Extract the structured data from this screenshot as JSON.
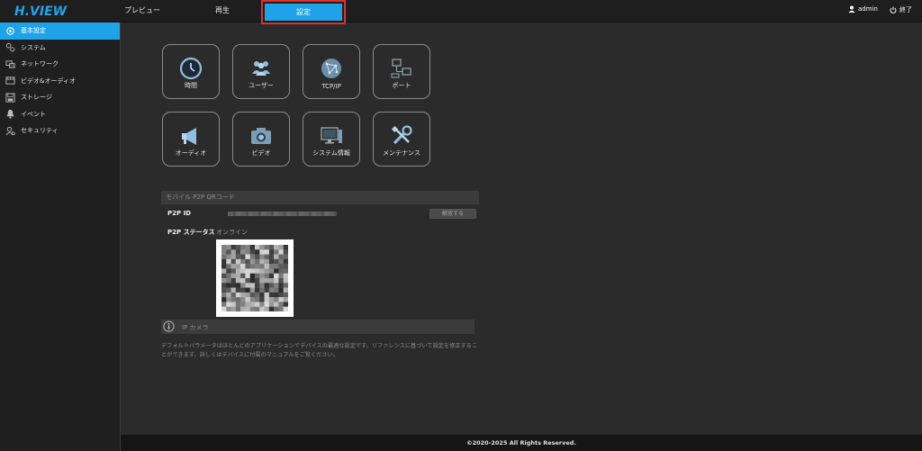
{
  "brand": {
    "logo_text": "H.VIEW",
    "accent": "#1fa3e8"
  },
  "nav": {
    "preview": "プレビュー",
    "playback": "再生",
    "settings": "設定"
  },
  "user": {
    "name": "admin",
    "logout": "終了"
  },
  "sidebar": {
    "items": [
      {
        "label": "基本設定",
        "icon": "gear-icon"
      },
      {
        "label": "システム",
        "icon": "gears-icon"
      },
      {
        "label": "ネットワーク",
        "icon": "network-icon"
      },
      {
        "label": "ビデオ&オーディオ",
        "icon": "film-icon"
      },
      {
        "label": "ストレージ",
        "icon": "disk-icon"
      },
      {
        "label": "イベント",
        "icon": "bell-icon"
      },
      {
        "label": "セキュリティ",
        "icon": "security-icon"
      }
    ]
  },
  "tiles": [
    {
      "label": "時間",
      "icon": "clock-icon"
    },
    {
      "label": "ユーザー",
      "icon": "users-icon"
    },
    {
      "label": "TCP/IP",
      "icon": "globe-icon"
    },
    {
      "label": "ポート",
      "icon": "port-icon"
    },
    {
      "label": "オーディオ",
      "icon": "megaphone-icon"
    },
    {
      "label": "ビデオ",
      "icon": "camera-icon"
    },
    {
      "label": "システム情報",
      "icon": "monitor-icon"
    },
    {
      "label": "メンテナンス",
      "icon": "tools-icon"
    }
  ],
  "p2p": {
    "section_title": "モバイル P2P QRコード",
    "id_label": "P2P ID",
    "unbind_button": "解放する",
    "status_label": "P2P ステータス",
    "status_value": "オンライン"
  },
  "info": {
    "title": "IP カメラ",
    "description": "デフォルトパラメータはほとんどのアプリケーションでデバイスの最適な設定です。リファレンスに基づいて設定を修正することができます。詳しくはデバイスに付属のマニュアルをご覧ください。"
  },
  "footer": {
    "copyright": "©2020-2025 All Rights Reserved."
  }
}
